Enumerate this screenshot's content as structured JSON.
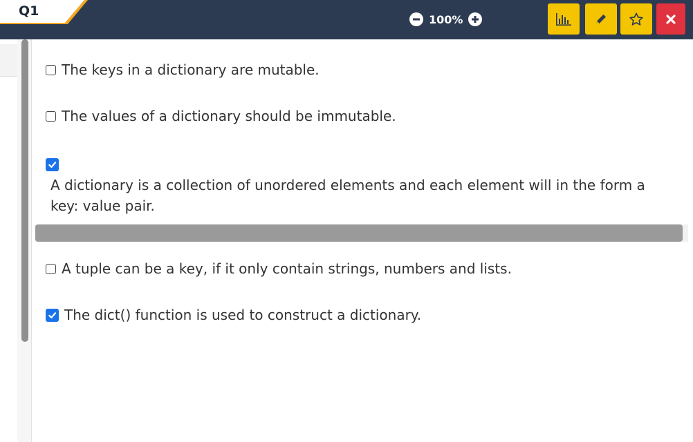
{
  "header": {
    "question_label": "Q1",
    "zoom_level": "100%"
  },
  "toolbar": {
    "buttons": [
      {
        "name": "stats",
        "icon": "bar-chart-icon",
        "color": "#f5c400"
      },
      {
        "name": "edit",
        "icon": "pencil-icon",
        "color": "#f5c400"
      },
      {
        "name": "favorite",
        "icon": "star-icon",
        "color": "#f5c400"
      },
      {
        "name": "close",
        "icon": "close-icon",
        "color": "#e0323f"
      }
    ]
  },
  "options": [
    {
      "text": "The keys in a dictionary are mutable.",
      "checked": false
    },
    {
      "text": "The values of a dictionary should be immutable.",
      "checked": false
    },
    {
      "text": "A dictionary is a collection of unordered elements and each element will in the form a key: value pair.",
      "checked": true
    },
    {
      "text": "A tuple can be a key, if it only contain strings, numbers and lists.",
      "checked": false
    },
    {
      "text": "The dict() function is used to construct a dictionary.",
      "checked": true
    }
  ],
  "colors": {
    "header_bg": "#2c3b52",
    "accent": "#f5a623",
    "toolbar_yellow": "#f5c400",
    "close_red": "#e0323f",
    "checkbox_blue": "#1a73e8"
  }
}
